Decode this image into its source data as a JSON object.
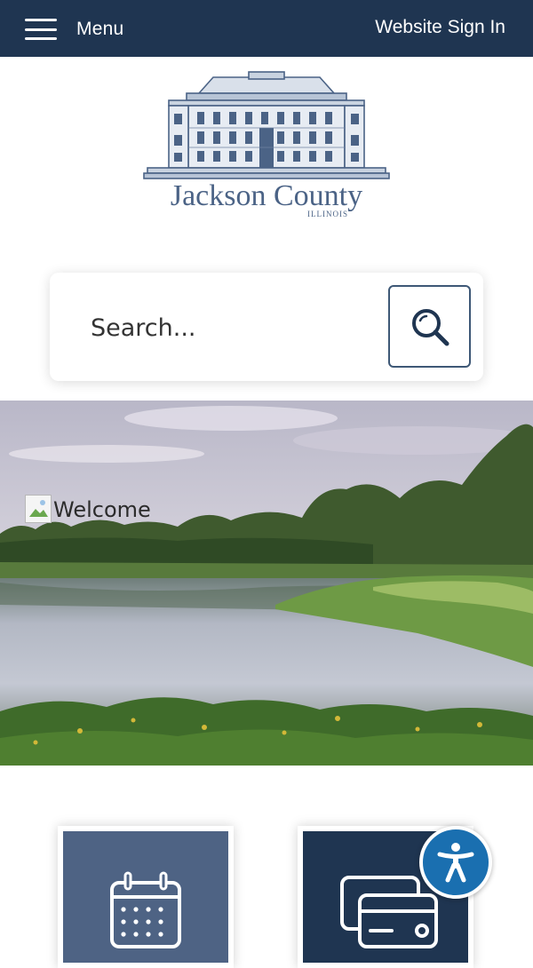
{
  "header": {
    "menu_label": "Menu",
    "menu_icon": "hamburger-icon",
    "sign_in_label": "Website Sign In",
    "background_color": "#1f3551"
  },
  "logo": {
    "name": "Jackson County",
    "subtitle": "ILLINOIS"
  },
  "search": {
    "placeholder": "Search...",
    "button_icon": "search-icon"
  },
  "hero": {
    "image_alt": "Welcome"
  },
  "tiles": [
    {
      "icon": "calendar-icon",
      "color": "#4e6384"
    },
    {
      "icon": "payment-card-icon",
      "color": "#1f3551"
    }
  ],
  "accessibility": {
    "icon": "accessibility-icon",
    "color": "#1a6fb0"
  }
}
